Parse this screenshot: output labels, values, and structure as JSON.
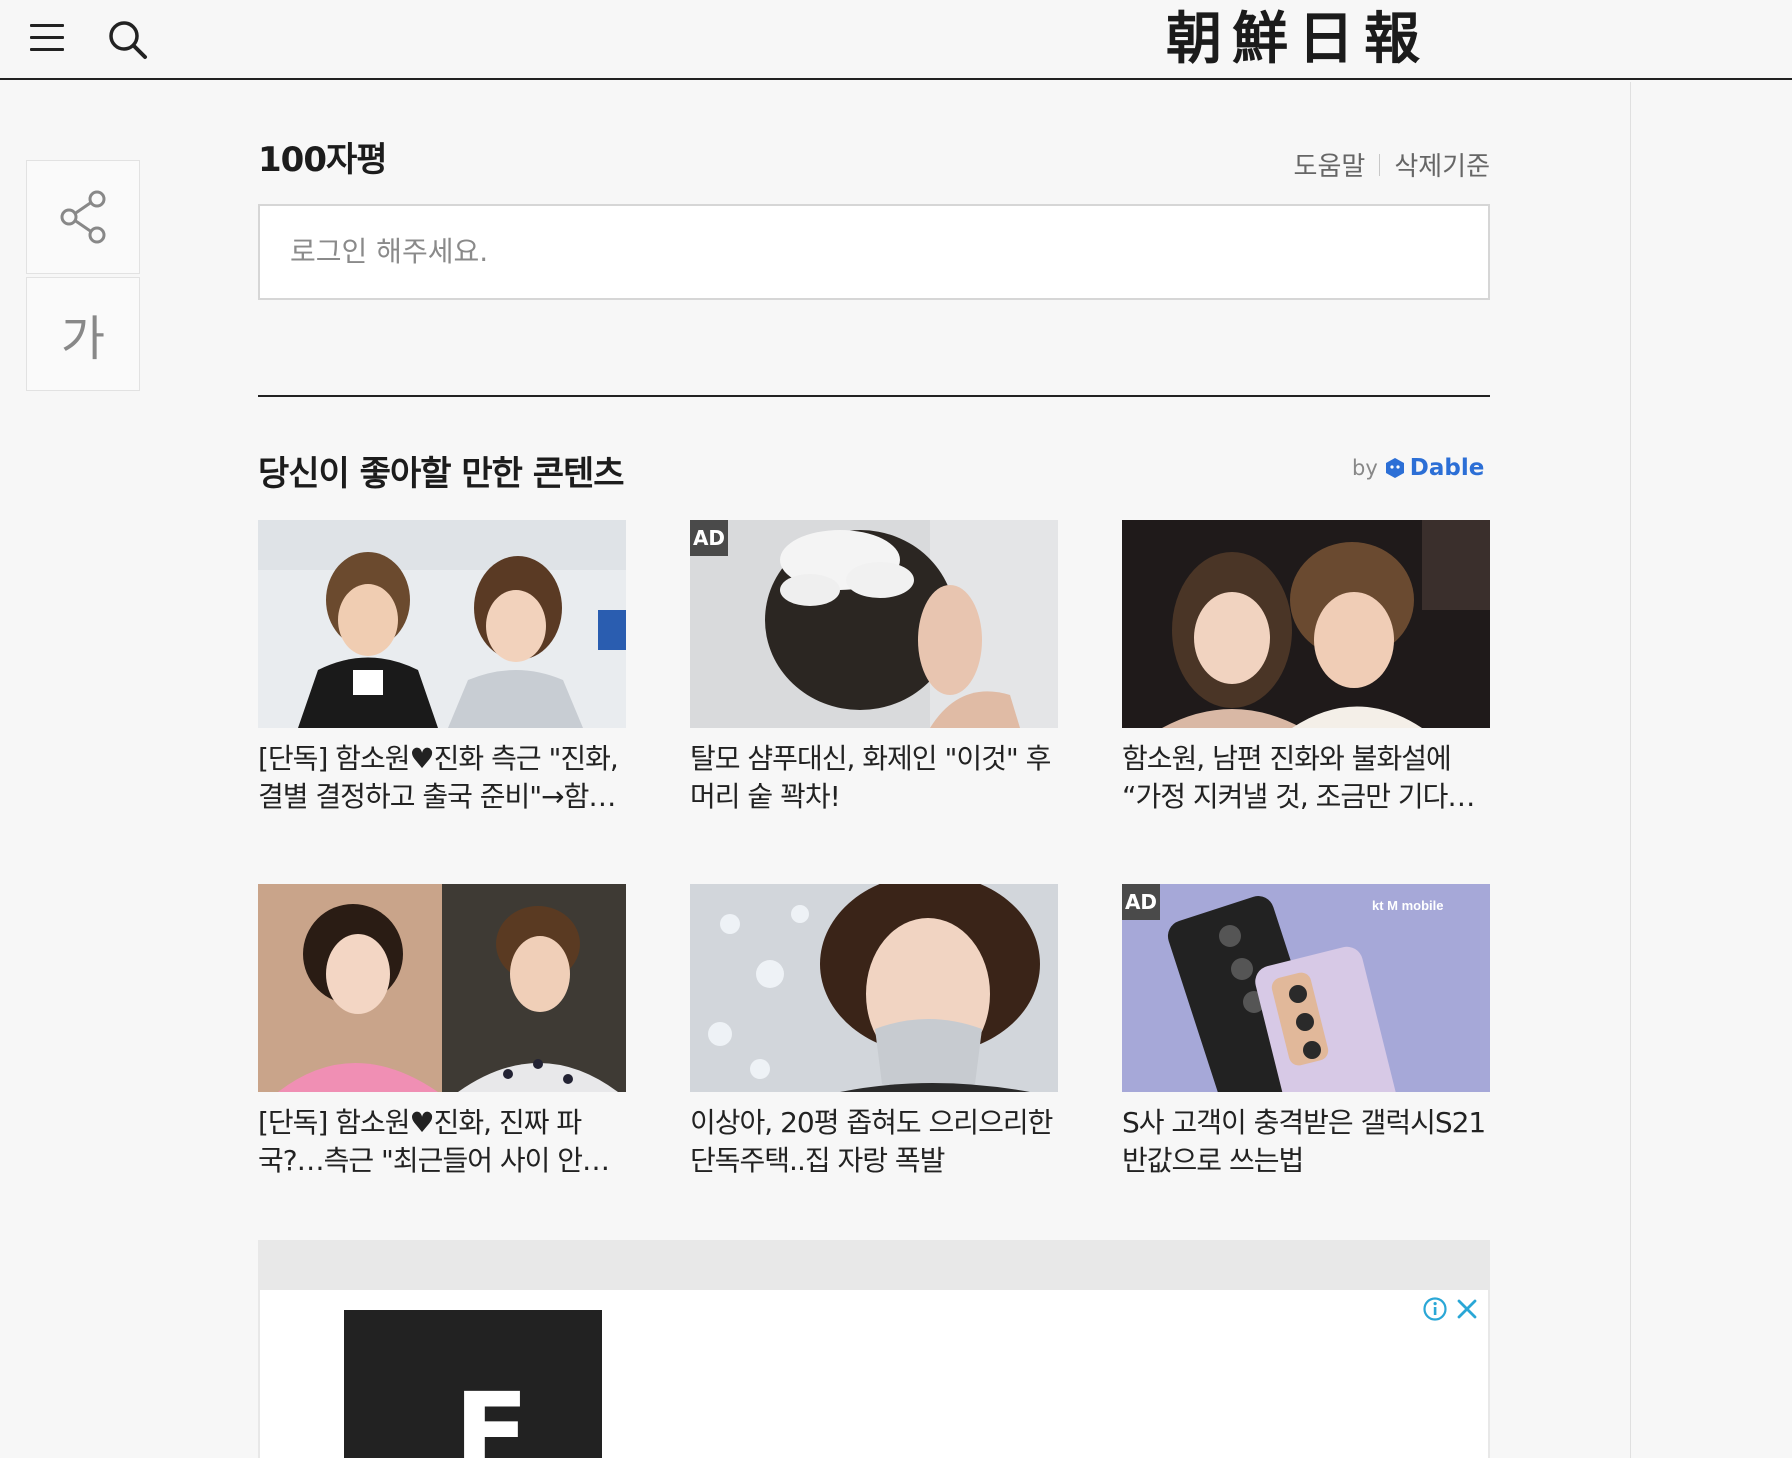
{
  "header": {
    "logo_text": "朝鮮日報",
    "menu_icon": "hamburger-menu-icon",
    "search_icon": "search-icon"
  },
  "side_tools": {
    "share_icon": "share-icon",
    "font_size_label": "가"
  },
  "comments": {
    "title": "100자평",
    "help_link": "도움말",
    "delete_policy_link": "삭제기준",
    "input_placeholder": "로그인 해주세요."
  },
  "recommendations": {
    "title": "당신이 좋아할 만한 콘텐츠",
    "by_label": "by",
    "brand": "Dable",
    "ad_badge": "AD",
    "items": [
      {
        "title": "[단독] 함소원♥진화 측근 \"진화, 결별 결정하고 출국 준비\"→함…",
        "is_ad": false
      },
      {
        "title": "탈모 샴푸대신, 화제인 \"이것\" 후 머리 숱 꽉차!",
        "is_ad": true
      },
      {
        "title": "함소원, 남편 진화와 불화설에 “가정 지켜낼 것, 조금만 기다…",
        "is_ad": false
      },
      {
        "title": "[단독] 함소원♥진화, 진짜 파국?…측근 \"최근들어 사이 안…",
        "is_ad": false
      },
      {
        "title": "이상아, 20평 좁혀도 으리으리한 단독주택..집 자랑 폭발",
        "is_ad": false
      },
      {
        "title": "S사 고객이 충격받은 갤럭시S21 반값으로 쓰는법",
        "is_ad": true,
        "thumb_brand": "kt M mobile"
      }
    ]
  },
  "ad_banner": {
    "logo_letter": "F",
    "info_icon": "info-icon",
    "close_icon": "close-icon"
  },
  "colors": {
    "background": "#f7f7f7",
    "dable_blue": "#2c6fd6",
    "ad_badge": "#4a4a4a"
  }
}
